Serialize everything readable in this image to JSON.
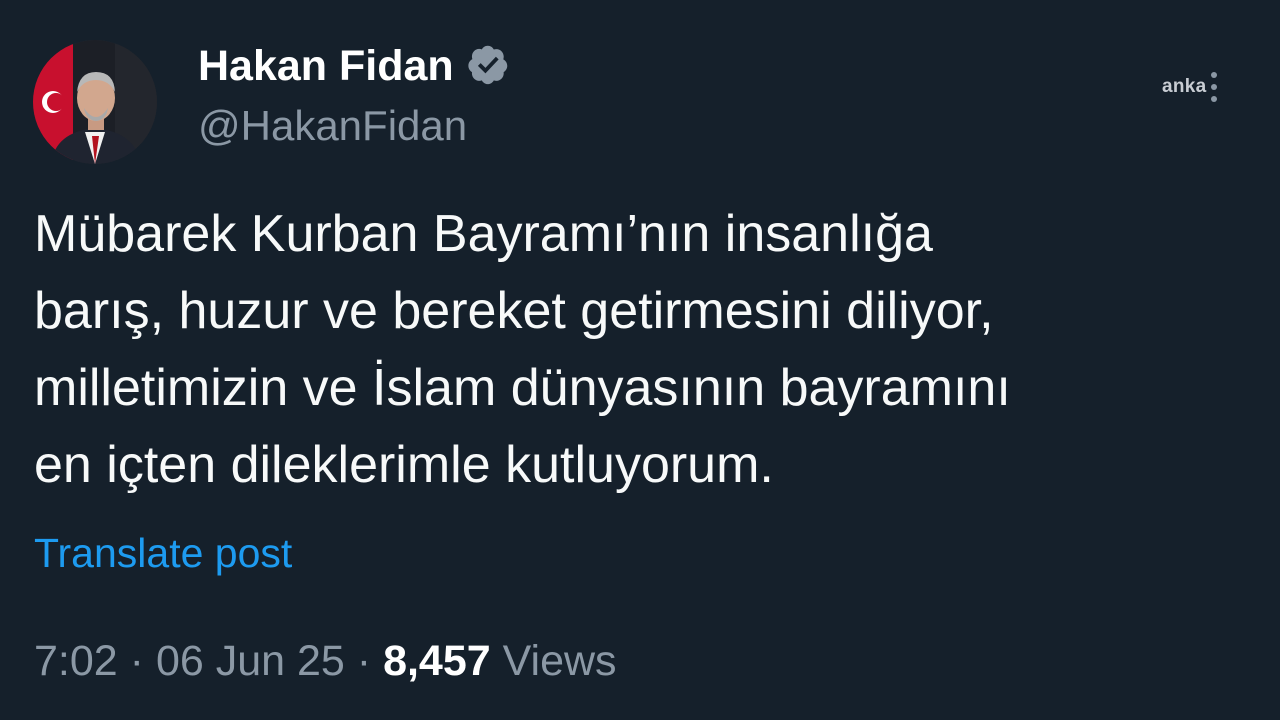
{
  "author": {
    "display_name": "Hakan Fidan",
    "handle": "@HakanFidan",
    "verified": true
  },
  "watermark": "anka",
  "post": {
    "text_lines": [
      "Mübarek Kurban Bayramı’nın insanlığa",
      "barış, huzur ve bereket getirmesini diliyor,",
      "milletimizin ve İslam dünyasının bayramını",
      "en içten dileklerimle kutluyorum."
    ],
    "translate_label": "Translate post"
  },
  "meta": {
    "time": "7:02",
    "separator": "·",
    "date": "06 Jun 25",
    "views_count": "8,457",
    "views_label": "Views"
  },
  "icons": {
    "verified": "verified-badge-icon",
    "more": "more-vertical-icon"
  },
  "colors": {
    "background": "#15202b",
    "link": "#1d9bf0",
    "secondary_text": "#8b98a5",
    "verified_badge": "#8b98a5"
  }
}
